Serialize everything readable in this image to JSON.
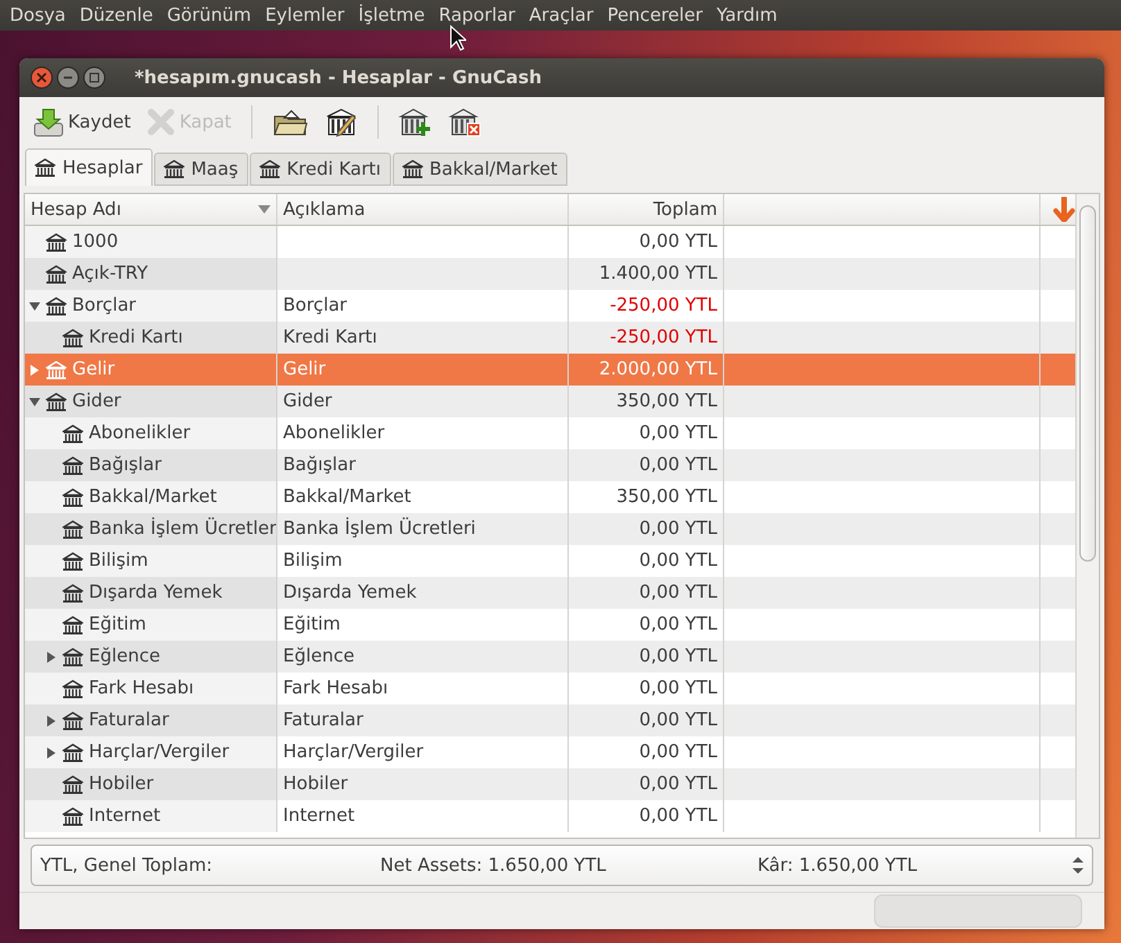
{
  "menu_bar": [
    "Dosya",
    "Düzenle",
    "Görünüm",
    "Eylemler",
    "İşletme",
    "Raporlar",
    "Araçlar",
    "Pencereler",
    "Yardım"
  ],
  "window": {
    "title": "*hesapım.gnucash - Hesaplar - GnuCash"
  },
  "toolbar": [
    {
      "kind": "save",
      "label": "Kaydet",
      "disabled": false
    },
    {
      "kind": "close",
      "label": "Kapat",
      "disabled": true
    },
    {
      "kind": "separator"
    },
    {
      "kind": "open",
      "disabled": false
    },
    {
      "kind": "edit",
      "disabled": false
    },
    {
      "kind": "separator"
    },
    {
      "kind": "new",
      "disabled": false
    },
    {
      "kind": "delete",
      "disabled": false
    }
  ],
  "tabs": [
    {
      "label": "Hesaplar",
      "selected": true
    },
    {
      "label": "Maaş",
      "selected": false
    },
    {
      "label": "Kredi Kartı",
      "selected": false
    },
    {
      "label": "Bakkal/Market",
      "selected": false
    }
  ],
  "table": {
    "columns": [
      "Hesap Adı",
      "Açıklama",
      "Toplam"
    ],
    "rows": [
      {
        "name": "1000",
        "description": "",
        "total": "0,00 YTL",
        "negative": false,
        "selected": false
      },
      {
        "name": "Açık-TRY",
        "description": "",
        "total": "1.400,00 YTL",
        "negative": false,
        "selected": false
      },
      {
        "name": "Borçlar",
        "description": "Borçlar",
        "total": "-250,00 YTL",
        "negative": true,
        "selected": false,
        "expanded": true,
        "children": [
          {
            "name": "Kredi Kartı",
            "description": "Kredi Kartı",
            "total": "-250,00 YTL",
            "negative": true,
            "selected": false
          }
        ]
      },
      {
        "name": "Gelir",
        "description": "Gelir",
        "total": "2.000,00 YTL",
        "negative": false,
        "selected": true,
        "expanded": false
      },
      {
        "name": "Gider",
        "description": "Gider",
        "total": "350,00 YTL",
        "negative": false,
        "selected": false,
        "expanded": true,
        "children": [
          {
            "name": "Abonelikler",
            "description": "Abonelikler",
            "total": "0,00 YTL",
            "negative": false,
            "selected": false
          },
          {
            "name": "Bağışlar",
            "description": "Bağışlar",
            "total": "0,00 YTL",
            "negative": false,
            "selected": false
          },
          {
            "name": "Bakkal/Market",
            "description": "Bakkal/Market",
            "total": "350,00 YTL",
            "negative": false,
            "selected": false
          },
          {
            "name": "Banka İşlem Ücretler",
            "description": "Banka İşlem Ücretleri",
            "total": "0,00 YTL",
            "negative": false,
            "selected": false
          },
          {
            "name": "Bilişim",
            "description": "Bilişim",
            "total": "0,00 YTL",
            "negative": false,
            "selected": false
          },
          {
            "name": "Dışarda Yemek",
            "description": "Dışarda Yemek",
            "total": "0,00 YTL",
            "negative": false,
            "selected": false
          },
          {
            "name": "Eğitim",
            "description": "Eğitim",
            "total": "0,00 YTL",
            "negative": false,
            "selected": false
          },
          {
            "name": "Eğlence",
            "description": "Eğlence",
            "total": "0,00 YTL",
            "negative": false,
            "selected": false,
            "expanded": false
          },
          {
            "name": "Fark Hesabı",
            "description": "Fark Hesabı",
            "total": "0,00 YTL",
            "negative": false,
            "selected": false
          },
          {
            "name": "Faturalar",
            "description": "Faturalar",
            "total": "0,00 YTL",
            "negative": false,
            "selected": false,
            "expanded": false
          },
          {
            "name": "Harçlar/Vergiler",
            "description": "Harçlar/Vergiler",
            "total": "0,00 YTL",
            "negative": false,
            "selected": false,
            "expanded": false
          },
          {
            "name": "Hobiler",
            "description": "Hobiler",
            "total": "0,00 YTL",
            "negative": false,
            "selected": false
          },
          {
            "name": "Internet",
            "description": "Internet",
            "total": "0,00 YTL",
            "negative": false,
            "selected": false
          }
        ]
      }
    ]
  },
  "summary": {
    "label": "YTL, Genel Toplam:",
    "net_assets": "Net Assets: 1.650,00 YTL",
    "profit": "Kâr: 1.650,00 YTL"
  },
  "status_bar": {
    "progress": {
      "level": 0
    }
  }
}
